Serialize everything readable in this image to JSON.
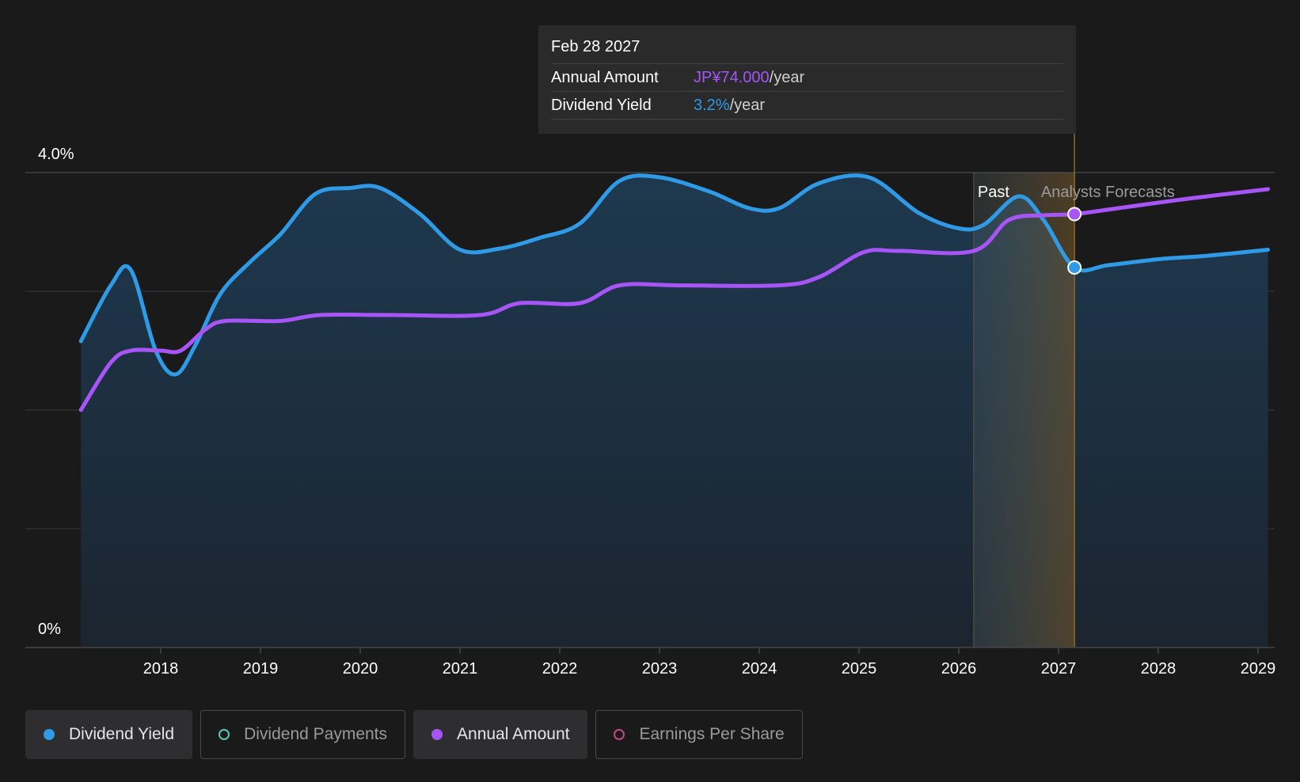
{
  "chart_data": {
    "type": "line",
    "y_axis": {
      "top_label": "4.0%",
      "bottom_label": "0%",
      "ylim": [
        0,
        4.0
      ],
      "gridlines": [
        0,
        1.0,
        2.0,
        3.0,
        4.0
      ]
    },
    "x_axis": {
      "ticks": [
        "2018",
        "2019",
        "2020",
        "2021",
        "2022",
        "2023",
        "2024",
        "2025",
        "2026",
        "2027",
        "2028",
        "2029"
      ],
      "range": [
        2017.2,
        2029.1
      ]
    },
    "regions": {
      "past_label": "Past",
      "forecast_label": "Analysts Forecasts",
      "past_end": 2026.15,
      "forecast_start": 2027.16
    },
    "series": [
      {
        "name": "Dividend Yield",
        "color": "#2f9be6",
        "points": [
          [
            2017.2,
            2.58
          ],
          [
            2017.5,
            3.05
          ],
          [
            2017.7,
            3.18
          ],
          [
            2017.95,
            2.5
          ],
          [
            2018.15,
            2.3
          ],
          [
            2018.35,
            2.55
          ],
          [
            2018.6,
            2.98
          ],
          [
            2018.9,
            3.25
          ],
          [
            2019.2,
            3.48
          ],
          [
            2019.55,
            3.82
          ],
          [
            2019.9,
            3.87
          ],
          [
            2020.2,
            3.87
          ],
          [
            2020.6,
            3.65
          ],
          [
            2021.0,
            3.35
          ],
          [
            2021.4,
            3.36
          ],
          [
            2021.8,
            3.45
          ],
          [
            2022.2,
            3.57
          ],
          [
            2022.6,
            3.93
          ],
          [
            2023.0,
            3.96
          ],
          [
            2023.5,
            3.84
          ],
          [
            2023.9,
            3.7
          ],
          [
            2024.2,
            3.7
          ],
          [
            2024.6,
            3.91
          ],
          [
            2025.1,
            3.96
          ],
          [
            2025.6,
            3.66
          ],
          [
            2026.0,
            3.53
          ],
          [
            2026.25,
            3.56
          ],
          [
            2026.6,
            3.8
          ],
          [
            2026.85,
            3.6
          ],
          [
            2027.16,
            3.2
          ],
          [
            2027.5,
            3.22
          ],
          [
            2028.0,
            3.27
          ],
          [
            2028.5,
            3.3
          ],
          [
            2029.1,
            3.35
          ]
        ]
      },
      {
        "name": "Annual Amount",
        "color": "#a855f7",
        "points": [
          [
            2017.2,
            2.0
          ],
          [
            2017.5,
            2.4
          ],
          [
            2017.7,
            2.5
          ],
          [
            2018.0,
            2.5
          ],
          [
            2018.2,
            2.5
          ],
          [
            2018.45,
            2.68
          ],
          [
            2018.65,
            2.75
          ],
          [
            2019.2,
            2.75
          ],
          [
            2019.6,
            2.8
          ],
          [
            2020.3,
            2.8
          ],
          [
            2021.2,
            2.8
          ],
          [
            2021.6,
            2.9
          ],
          [
            2022.2,
            2.9
          ],
          [
            2022.6,
            3.05
          ],
          [
            2023.2,
            3.05
          ],
          [
            2024.2,
            3.05
          ],
          [
            2024.6,
            3.12
          ],
          [
            2025.05,
            3.33
          ],
          [
            2025.4,
            3.34
          ],
          [
            2026.15,
            3.34
          ],
          [
            2026.5,
            3.6
          ],
          [
            2026.85,
            3.64
          ],
          [
            2027.16,
            3.65
          ],
          [
            2027.6,
            3.7
          ],
          [
            2028.3,
            3.78
          ],
          [
            2029.1,
            3.86
          ]
        ]
      }
    ],
    "highlight": {
      "x": 2027.16,
      "dividend_yield": 3.2,
      "annual_amount": 3.65
    },
    "tooltip": {
      "date": "Feb 28 2027",
      "rows": [
        {
          "label": "Annual Amount",
          "value": "JP¥74.000",
          "unit": "/year",
          "color": "#a855f7"
        },
        {
          "label": "Dividend Yield",
          "value": "3.2%",
          "unit": "/year",
          "color": "#2f9be6"
        }
      ]
    }
  },
  "legend": [
    {
      "label": "Dividend Yield",
      "active": true,
      "color": "#2f9be6",
      "filled": true
    },
    {
      "label": "Dividend Payments",
      "active": false,
      "color": "#5ec7b8",
      "filled": false
    },
    {
      "label": "Annual Amount",
      "active": true,
      "color": "#a855f7",
      "filled": true
    },
    {
      "label": "Earnings Per Share",
      "active": false,
      "color": "#c24a86",
      "filled": false
    }
  ]
}
